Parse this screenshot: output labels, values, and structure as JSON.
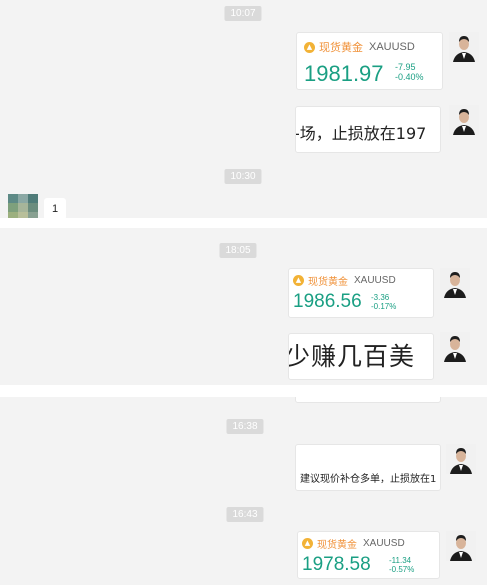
{
  "theme": {
    "accent_up": "#1a9f83",
    "label_orange": "#f0923a",
    "gold": "#f2b236",
    "panel_bg": "#f3f3f3",
    "timestamp_bg": "#dadada"
  },
  "section1": {
    "time_1": "10:07",
    "quote": {
      "icon": "gold-coin-icon",
      "name": "现货黄金",
      "symbol": "XAUUSD",
      "price": "1981.97",
      "change": "-7.95",
      "change_pct": "-0.40%"
    },
    "text_fragment": "-",
    "time_2": "10:30",
    "reply_text": "1"
  },
  "section2": {
    "time": "18:05",
    "quote": {
      "icon": "gold-coin-icon",
      "name": "现货黄金",
      "symbol": "XAUUSD",
      "price": "1986.56",
      "change": "-3.36",
      "change_pct": "-0.17%"
    },
    "text_fragment": "少赚几百美"
  },
  "section3": {
    "time_1": "16:38",
    "text_fragment": "建议现价补仓多单，止损放在1",
    "time_2": "16:43",
    "quote": {
      "icon": "gold-coin-icon",
      "name": "现货黄金",
      "symbol": "XAUUSD",
      "price": "1978.58",
      "change": "-11.34",
      "change_pct": "-0.57%"
    }
  }
}
